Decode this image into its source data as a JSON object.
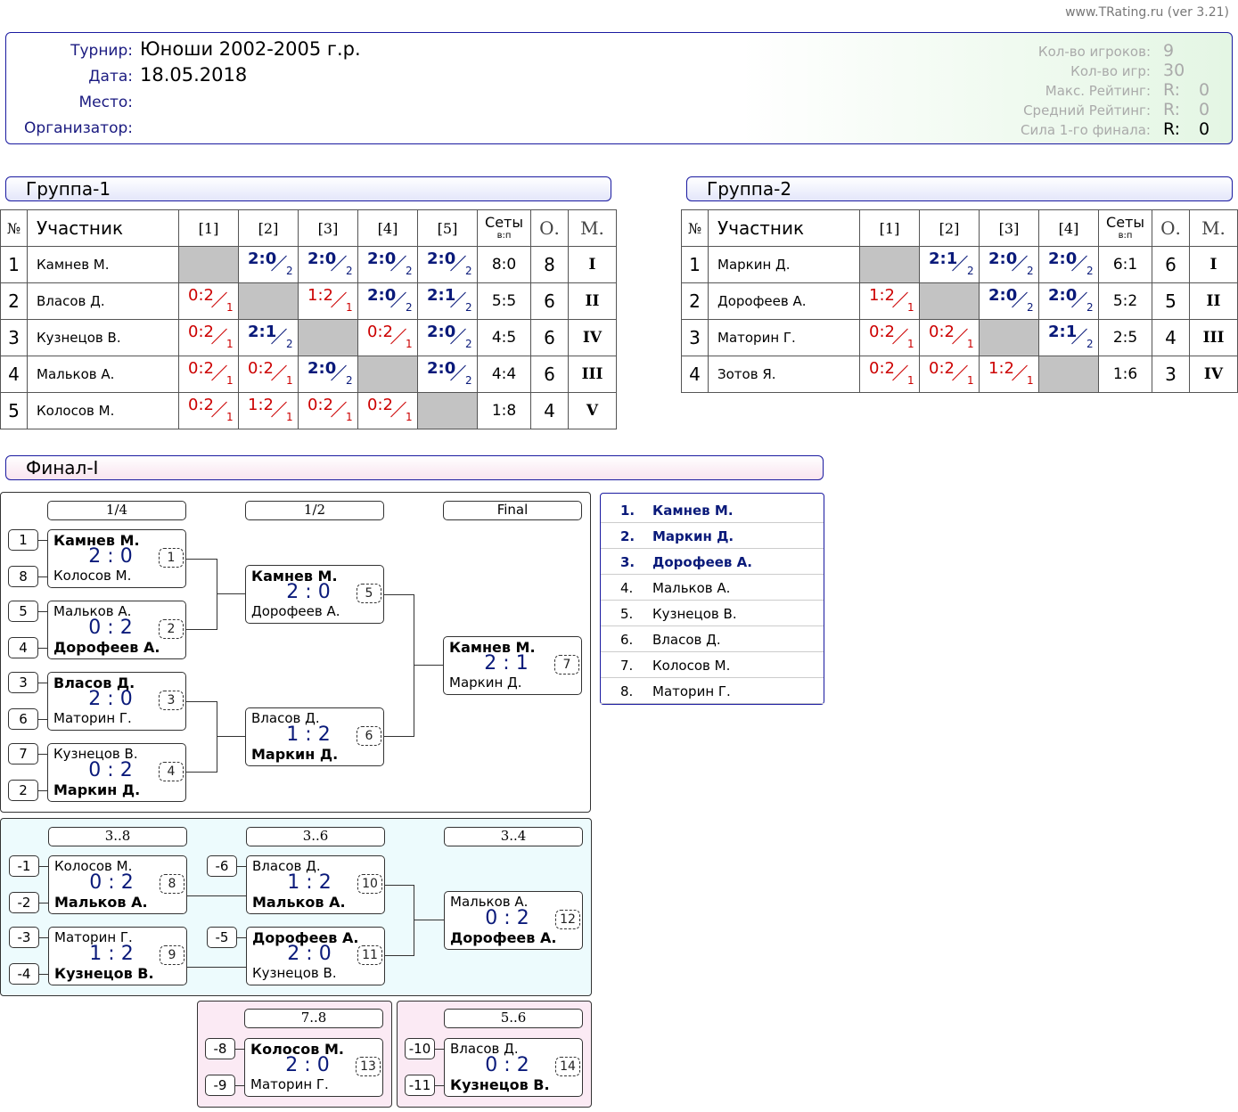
{
  "site": "www.TRating.ru (ver 3.21)",
  "header": {
    "labels": [
      "Турнир:",
      "Дата:",
      "Место:",
      "Организатор:"
    ],
    "tournament": "Юноши 2002-2005 г.р.",
    "date": "18.05.2018",
    "place": "",
    "organizer": "",
    "stats": [
      {
        "label": "Кол-во игроков:",
        "value": "9"
      },
      {
        "label": "Кол-во игр:",
        "value": "30"
      },
      {
        "label": "Макс. Рейтинг:",
        "r": "R:",
        "value": "0"
      },
      {
        "label": "Средний Рейтинг:",
        "r": "R:",
        "value": "0"
      },
      {
        "label": "Сила 1-го финала:",
        "r": "R:",
        "value": "0"
      }
    ]
  },
  "table_headers": {
    "no": "№",
    "name": "Участник",
    "sets": "Сеты",
    "sets_sub": "в:п",
    "points": "О.",
    "place": "М."
  },
  "groups": [
    {
      "title": "Группа-1",
      "cols": [
        "[1]",
        "[2]",
        "[3]",
        "[4]",
        "[5]"
      ],
      "rows": [
        {
          "no": "1",
          "name": "Камнев М.",
          "cells": [
            null,
            [
              "2:0",
              "2",
              "w"
            ],
            [
              "2:0",
              "2",
              "w"
            ],
            [
              "2:0",
              "2",
              "w"
            ],
            [
              "2:0",
              "2",
              "w"
            ]
          ],
          "sets": "8:0",
          "pts": "8",
          "place": "I"
        },
        {
          "no": "2",
          "name": "Власов Д.",
          "cells": [
            [
              "0:2",
              "1",
              "l"
            ],
            null,
            [
              "1:2",
              "1",
              "l"
            ],
            [
              "2:0",
              "2",
              "w"
            ],
            [
              "2:1",
              "2",
              "w"
            ]
          ],
          "sets": "5:5",
          "pts": "6",
          "place": "II"
        },
        {
          "no": "3",
          "name": "Кузнецов В.",
          "cells": [
            [
              "0:2",
              "1",
              "l"
            ],
            [
              "2:1",
              "2",
              "w"
            ],
            null,
            [
              "0:2",
              "1",
              "l"
            ],
            [
              "2:0",
              "2",
              "w"
            ]
          ],
          "sets": "4:5",
          "pts": "6",
          "place": "IV"
        },
        {
          "no": "4",
          "name": "Мальков А.",
          "cells": [
            [
              "0:2",
              "1",
              "l"
            ],
            [
              "0:2",
              "1",
              "l"
            ],
            [
              "2:0",
              "2",
              "w"
            ],
            null,
            [
              "2:0",
              "2",
              "w"
            ]
          ],
          "sets": "4:4",
          "pts": "6",
          "place": "III"
        },
        {
          "no": "5",
          "name": "Колосов М.",
          "cells": [
            [
              "0:2",
              "1",
              "l"
            ],
            [
              "1:2",
              "1",
              "l"
            ],
            [
              "0:2",
              "1",
              "l"
            ],
            [
              "0:2",
              "1",
              "l"
            ],
            null
          ],
          "sets": "1:8",
          "pts": "4",
          "place": "V"
        }
      ]
    },
    {
      "title": "Группа-2",
      "cols": [
        "[1]",
        "[2]",
        "[3]",
        "[4]"
      ],
      "rows": [
        {
          "no": "1",
          "name": "Маркин Д.",
          "cells": [
            null,
            [
              "2:1",
              "2",
              "w"
            ],
            [
              "2:0",
              "2",
              "w"
            ],
            [
              "2:0",
              "2",
              "w"
            ]
          ],
          "sets": "6:1",
          "pts": "6",
          "place": "I"
        },
        {
          "no": "2",
          "name": "Дорофеев А.",
          "cells": [
            [
              "1:2",
              "1",
              "l"
            ],
            null,
            [
              "2:0",
              "2",
              "w"
            ],
            [
              "2:0",
              "2",
              "w"
            ]
          ],
          "sets": "5:2",
          "pts": "5",
          "place": "II"
        },
        {
          "no": "3",
          "name": "Маторин Г.",
          "cells": [
            [
              "0:2",
              "1",
              "l"
            ],
            [
              "0:2",
              "1",
              "l"
            ],
            null,
            [
              "2:1",
              "2",
              "w"
            ]
          ],
          "sets": "2:5",
          "pts": "4",
          "place": "III"
        },
        {
          "no": "4",
          "name": "Зотов Я.",
          "cells": [
            [
              "0:2",
              "1",
              "l"
            ],
            [
              "0:2",
              "1",
              "l"
            ],
            [
              "1:2",
              "1",
              "l"
            ],
            null
          ],
          "sets": "1:6",
          "pts": "3",
          "place": "IV"
        }
      ]
    }
  ],
  "final": {
    "title": "Финал-I",
    "round_labels": [
      "1/4",
      "1/2",
      "Final",
      "3..8",
      "3..6",
      "3..4",
      "7..8",
      "5..6"
    ],
    "seeds": [
      "1",
      "8",
      "5",
      "4",
      "3",
      "6",
      "7",
      "2",
      "-1",
      "-2",
      "-3",
      "-4",
      "-6",
      "-5",
      "-8",
      "-9",
      "-10",
      "-11"
    ],
    "matches": [
      {
        "p1": "Камнев М.",
        "p2": "Колосов М.",
        "score": "2 : 0",
        "n": "1",
        "w": 1
      },
      {
        "p1": "Мальков А.",
        "p2": "Дорофеев А.",
        "score": "0 : 2",
        "n": "2",
        "w": 2
      },
      {
        "p1": "Власов Д.",
        "p2": "Маторин Г.",
        "score": "2 : 0",
        "n": "3",
        "w": 1
      },
      {
        "p1": "Кузнецов В.",
        "p2": "Маркин Д.",
        "score": "0 : 2",
        "n": "4",
        "w": 2
      },
      {
        "p1": "Камнев М.",
        "p2": "Дорофеев А.",
        "score": "2 : 0",
        "n": "5",
        "w": 1
      },
      {
        "p1": "Власов Д.",
        "p2": "Маркин Д.",
        "score": "1 : 2",
        "n": "6",
        "w": 2
      },
      {
        "p1": "Камнев М.",
        "p2": "Маркин Д.",
        "score": "2 : 1",
        "n": "7",
        "w": 1
      },
      {
        "p1": "Колосов М.",
        "p2": "Мальков А.",
        "score": "0 : 2",
        "n": "8",
        "w": 2
      },
      {
        "p1": "Маторин Г.",
        "p2": "Кузнецов В.",
        "score": "1 : 2",
        "n": "9",
        "w": 2
      },
      {
        "p1": "Власов Д.",
        "p2": "Мальков А.",
        "score": "1 : 2",
        "n": "10",
        "w": 2
      },
      {
        "p1": "Дорофеев А.",
        "p2": "Кузнецов В.",
        "score": "2 : 0",
        "n": "11",
        "w": 1
      },
      {
        "p1": "Мальков А.",
        "p2": "Дорофеев А.",
        "score": "0 : 2",
        "n": "12",
        "w": 2
      },
      {
        "p1": "Колосов М.",
        "p2": "Маторин Г.",
        "score": "2 : 0",
        "n": "13",
        "w": 1
      },
      {
        "p1": "Власов Д.",
        "p2": "Кузнецов В.",
        "score": "0 : 2",
        "n": "14",
        "w": 2
      }
    ],
    "standings": [
      {
        "pos": "1.",
        "name": "Камнев М."
      },
      {
        "pos": "2.",
        "name": "Маркин Д."
      },
      {
        "pos": "3.",
        "name": "Дорофеев А."
      },
      {
        "pos": "4.",
        "name": "Мальков А."
      },
      {
        "pos": "5.",
        "name": "Кузнецов В."
      },
      {
        "pos": "6.",
        "name": "Власов Д."
      },
      {
        "pos": "7.",
        "name": "Колосов М."
      },
      {
        "pos": "8.",
        "name": "Маторин Г."
      }
    ]
  }
}
